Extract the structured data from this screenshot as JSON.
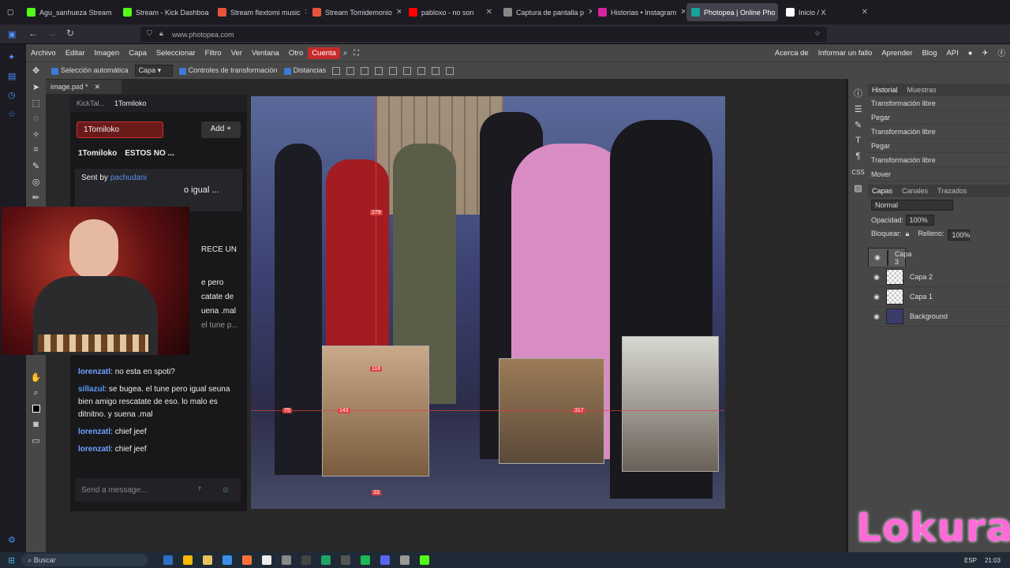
{
  "browser": {
    "tabs": [
      {
        "label": "Agu_sanhueza Stream",
        "color": "#53fc18"
      },
      {
        "label": "Stream - Kick Dashboa",
        "color": "#53fc18"
      },
      {
        "label": "Stream flextomi music",
        "color": "#e8533c"
      },
      {
        "label": "Stream Tomidemonio",
        "color": "#e8533c"
      },
      {
        "label": "pabloxo - no son",
        "color": "#ff0000"
      },
      {
        "label": "Captura de pantalla p",
        "color": "#888"
      },
      {
        "label": "Historias • Instagram",
        "color": "#d6249f"
      },
      {
        "label": "Photopea | Online Pho",
        "color": "#18a497"
      },
      {
        "label": "Inicio / X",
        "color": "#ffffff"
      }
    ],
    "url": "www.photopea.com"
  },
  "menu": {
    "items": [
      "Archivo",
      "Editar",
      "Imagen",
      "Capa",
      "Seleccionar",
      "Filtro",
      "Ver",
      "Ventana",
      "Otro",
      "Cuenta"
    ],
    "right_items": [
      "Acerca de",
      "Informar un fallo",
      "Aprender",
      "Blog",
      "API"
    ]
  },
  "options": {
    "auto_select": "Selección automática",
    "auto_select_value": "Capa",
    "transform_controls": "Controles de transformación",
    "distances": "Distancias"
  },
  "document": {
    "tab": "image.psd *"
  },
  "history": {
    "tabs": [
      "Historial",
      "Muestras"
    ],
    "items": [
      "Transformación libre",
      "Pegar",
      "Transformación libre",
      "Pegar",
      "Transformación libre",
      "Mover"
    ]
  },
  "layers": {
    "tabs": [
      "Capas",
      "Canales",
      "Trazados"
    ],
    "blend_mode": "Normal",
    "opacity_label": "Opacidad:",
    "opacity_value": "100%",
    "lock_label": "Bloquear:",
    "fill_label": "Relleno:",
    "fill_value": "100%",
    "items": [
      "Capa 3",
      "Capa 2",
      "Capa 1",
      "Background"
    ]
  },
  "chat": {
    "tab_inactive": "KickTal...",
    "tab_active": "1Tomiloko",
    "channel_chip": "1Tomiloko",
    "add_label": "Add",
    "channel_title": "1Tomiloko",
    "title_snippet": "ESTOS NO ...",
    "sent_by_label": "Sent by",
    "sent_by_user": "pachudani",
    "pinned_snippet": "o igual ...",
    "snippet_1": "RECE UN",
    "snippet_2": "e pero",
    "snippet_3": "catate de",
    "snippet_4": "uena .mal",
    "snippet_5": "el tune p...",
    "messages": [
      {
        "user": "lorenzatl",
        "text": "no esta en spoti?"
      },
      {
        "user": "sillazul",
        "text": "se bugea. el tune pero igual seuna bien amigo rescatate de eso. lo malo es ditnitno. y suena .mal"
      },
      {
        "user": "lorenzatl",
        "text": "chief jeef"
      },
      {
        "user": "lorenzatl",
        "text": "chief jeef"
      }
    ],
    "input_placeholder": "Send a message..."
  },
  "canvas": {
    "measure_labels": [
      "279",
      "116",
      "143",
      "75",
      "317",
      "33"
    ]
  },
  "overlay": {
    "watermark": "Lokura"
  },
  "taskbar": {
    "search": "Buscar",
    "lang": "ESP",
    "time": "21:03"
  }
}
